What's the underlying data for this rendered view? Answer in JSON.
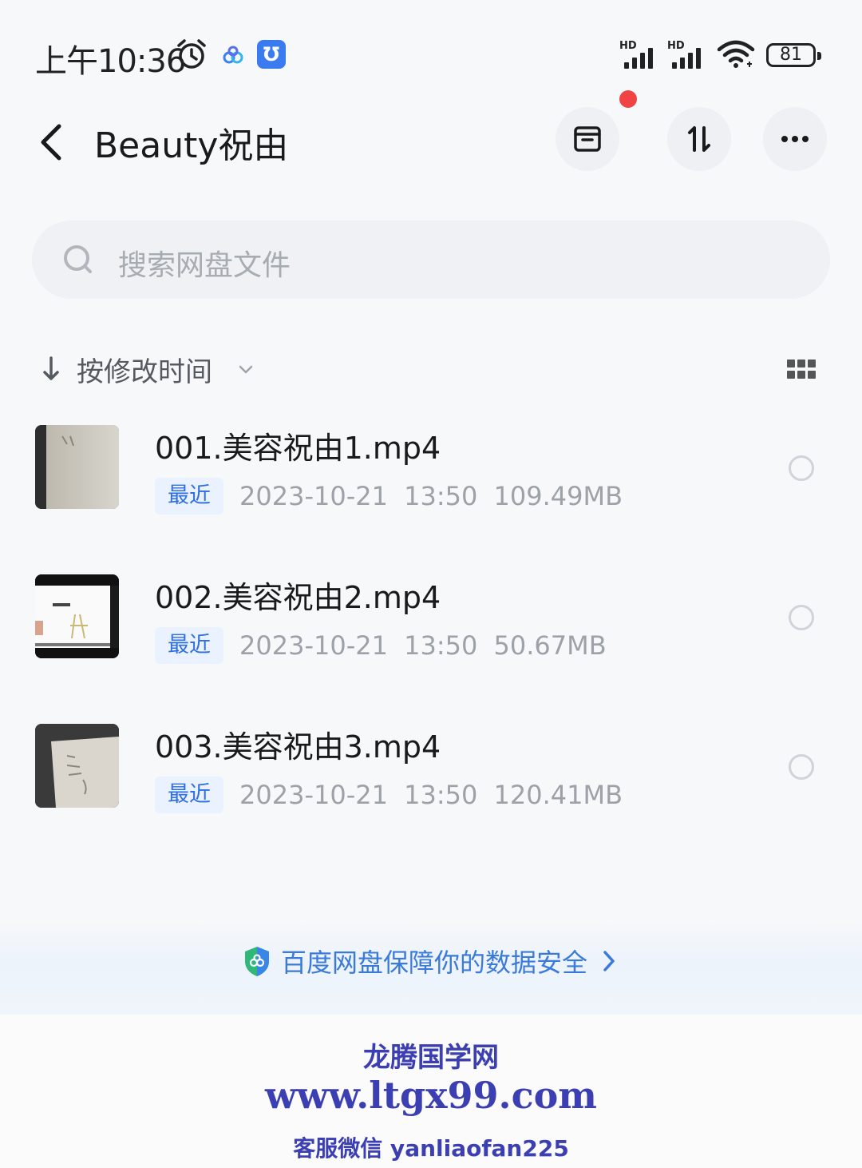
{
  "status_bar": {
    "time": "上午10:36",
    "hd_label": "HD",
    "battery": "81"
  },
  "header": {
    "title": "Beauty祝由"
  },
  "search": {
    "placeholder": "搜索网盘文件"
  },
  "sort": {
    "label": "按修改时间"
  },
  "files": [
    {
      "name": "001.美容祝由1.mp4",
      "badge": "最近",
      "date": "2023-10-21",
      "time": "13:50",
      "size": "109.49MB"
    },
    {
      "name": "002.美容祝由2.mp4",
      "badge": "最近",
      "date": "2023-10-21",
      "time": "13:50",
      "size": "50.67MB"
    },
    {
      "name": "003.美容祝由3.mp4",
      "badge": "最近",
      "date": "2023-10-21",
      "time": "13:50",
      "size": "120.41MB"
    }
  ],
  "safety_banner": {
    "text": "百度网盘保障你的数据安全"
  },
  "watermark": {
    "name": "龙腾国学网",
    "url": "www.ltgx99.com",
    "contact": "客服微信 yanliaofan225"
  },
  "colors": {
    "accent": "#3a7ad9",
    "badge_bg": "#eaf1ff",
    "notification_dot": "#f04444",
    "watermark": "#3b3fb2"
  }
}
